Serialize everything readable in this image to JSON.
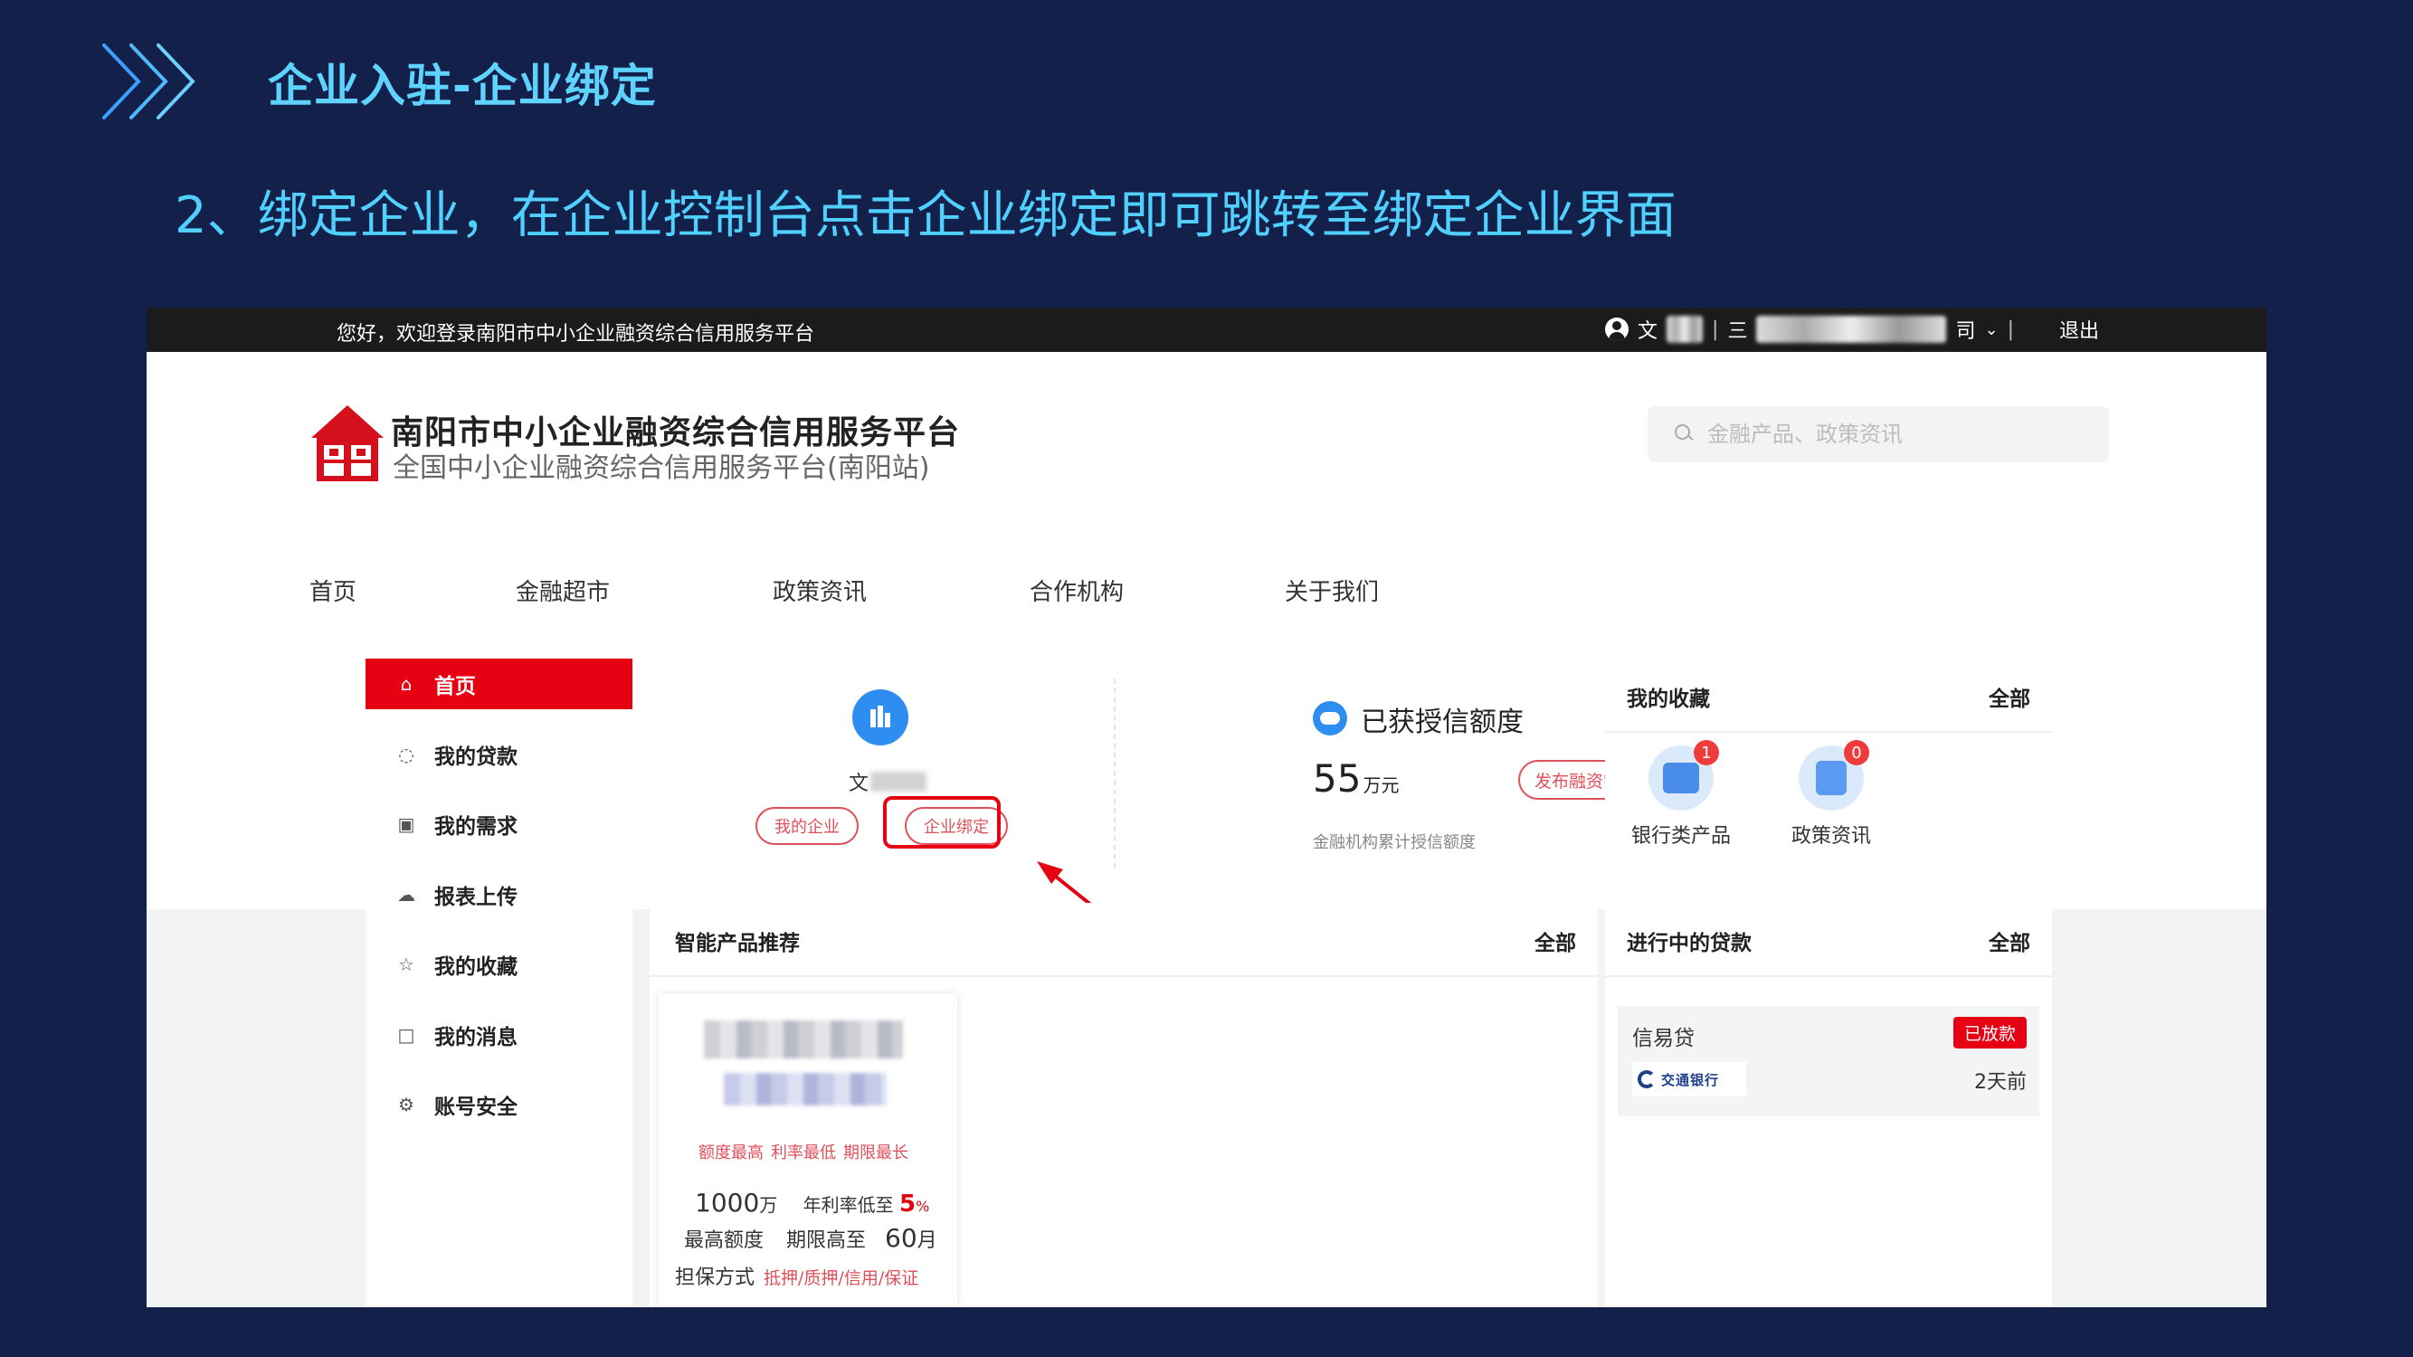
{
  "slide": {
    "title": "企业入驻-企业绑定",
    "subtitle": "2、绑定企业，在企业控制台点击企业绑定即可跳转至绑定企业界面"
  },
  "topbar": {
    "welcome": "您好，欢迎登录南阳市中小企业融资综合信用服务平台",
    "user_prefix": "文",
    "separator": "|",
    "company_prefix": "三",
    "company_suffix": "司",
    "logout": "退出"
  },
  "header": {
    "logo_title": "南阳市中小企业融资综合信用服务平台",
    "logo_subtitle": "全国中小企业融资综合信用服务平台(南阳站)",
    "search_placeholder": "金融产品、政策资讯",
    "nav": [
      "首页",
      "金融超市",
      "政策资讯",
      "合作机构",
      "关于我们"
    ]
  },
  "sidebar": {
    "items": [
      {
        "label": "首页",
        "icon": "home-icon"
      },
      {
        "label": "我的贷款",
        "icon": "coins-icon"
      },
      {
        "label": "我的需求",
        "icon": "request-icon"
      },
      {
        "label": "报表上传",
        "icon": "upload-cloud-icon"
      },
      {
        "label": "我的收藏",
        "icon": "star-icon"
      },
      {
        "label": "我的消息",
        "icon": "message-icon"
      },
      {
        "label": "账号安全",
        "icon": "gear-icon"
      }
    ]
  },
  "profile": {
    "name_prefix": "文",
    "my_company_btn": "我的企业",
    "bind_btn": "企业绑定",
    "credit_title": "已获授信额度",
    "credit_amount": "55",
    "credit_unit": "万元",
    "publish_btn": "发布融资需求",
    "credit_note": "金融机构累计授信额度"
  },
  "favorites": {
    "title": "我的收藏",
    "all": "全部",
    "items": [
      {
        "label": "银行类产品",
        "badge": "1"
      },
      {
        "label": "政策资讯",
        "badge": "0"
      }
    ]
  },
  "products": {
    "title": "智能产品推荐",
    "all": "全部",
    "tags": [
      "额度最高",
      "利率最低",
      "期限最长"
    ],
    "amount_value": "1000",
    "amount_unit": "万",
    "rate_label": "年利率低至",
    "rate_value": "5",
    "rate_unit": "%",
    "amount_label": "最高额度",
    "term_label": "期限高至",
    "term_value": "60",
    "term_unit": "月",
    "guarantee_label": "担保方式",
    "guarantee_value": "抵押/质押/信用/保证"
  },
  "loans": {
    "title": "进行中的贷款",
    "all": "全部",
    "item": {
      "name": "信易贷",
      "status": "已放款",
      "bank": "交通银行",
      "time": "2天前"
    }
  },
  "colors": {
    "slide_bg": "#13204a",
    "accent_red": "#e60012",
    "title_cyan": "#5fd3ff",
    "blue_icon": "#2e8df0"
  }
}
